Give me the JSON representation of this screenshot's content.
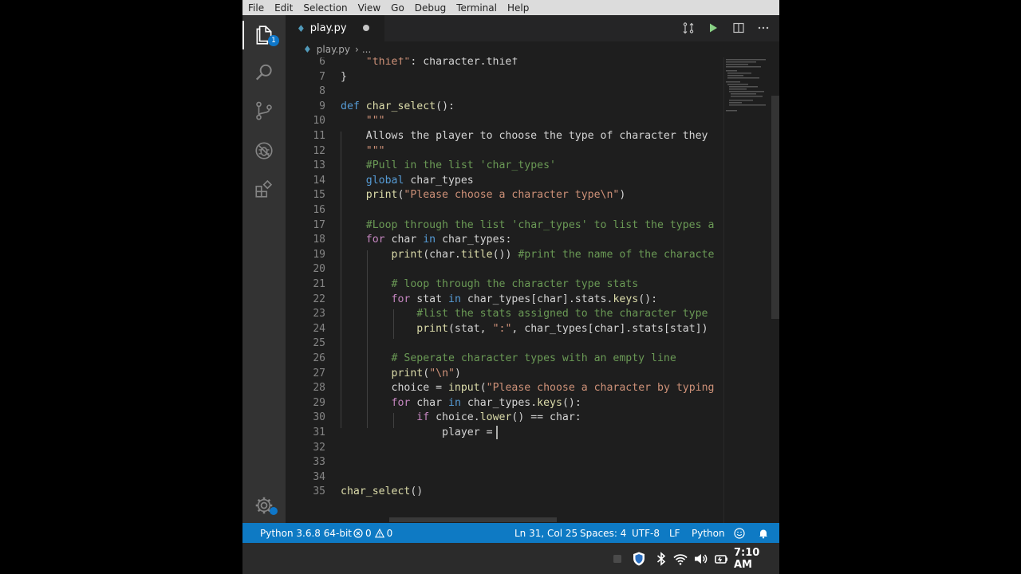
{
  "menu": [
    "File",
    "Edit",
    "Selection",
    "View",
    "Go",
    "Debug",
    "Terminal",
    "Help"
  ],
  "activity_bar": {
    "explorer_badge": "1",
    "items": [
      "explorer-icon",
      "search-icon",
      "source-control-icon",
      "debug-icon",
      "extensions-icon",
      "manage-gear-icon"
    ]
  },
  "tab": {
    "icon": "python-icon",
    "label": "play.py",
    "dirty": true
  },
  "editor_actions": [
    "open-changes-icon",
    "run-icon",
    "split-editor-icon",
    "more-actions-icon"
  ],
  "breadcrumb": {
    "file": "play.py",
    "more": "..."
  },
  "editor": {
    "line_numbers": [
      "6",
      "7",
      "8",
      "9",
      "10",
      "11",
      "12",
      "13",
      "14",
      "15",
      "16",
      "17",
      "18",
      "19",
      "20",
      "21",
      "22",
      "23",
      "24",
      "25",
      "26",
      "27",
      "28",
      "29",
      "30",
      "31",
      "32",
      "33",
      "34",
      "35"
    ],
    "lines": [
      "    \"thief\": character.thief",
      "}",
      "",
      "def char_select():",
      "    \"\"\"",
      "    Allows the player to choose the type of character they",
      "    \"\"\"",
      "    #Pull in the list 'char_types'",
      "    global char_types",
      "    print(\"Please choose a character type\\n\")",
      "",
      "    #Loop through the list 'char_types' to list the types a",
      "    for char in char_types:",
      "        print(char.title()) #print the name of the characte",
      "",
      "        # loop through the character type stats",
      "        for stat in char_types[char].stats.keys():",
      "            #list the stats assigned to the character type",
      "            print(stat, \":\", char_types[char].stats[stat])",
      "",
      "        # Seperate character types with an empty line",
      "        print(\"\\n\")",
      "        choice = input(\"Please choose a character by typing",
      "        for char in char_types.keys():",
      "            if choice.lower() == char:",
      "                player = ",
      "",
      "",
      "",
      "char_select()"
    ]
  },
  "status_bar": {
    "interpreter": "Python 3.6.8 64-bit",
    "errors": "0",
    "warnings": "0",
    "cursor_position": "Ln 31, Col 25",
    "indentation": "Spaces: 4",
    "encoding": "UTF-8",
    "eol": "LF",
    "language": "Python"
  },
  "taskbar": {
    "tray_icons": [
      "notification-icon",
      "shield-icon",
      "bluetooth-icon",
      "wifi-icon",
      "volume-icon",
      "battery-icon"
    ],
    "clock": "7:10 AM"
  },
  "colors": {
    "status_bar": "#0e7ac4",
    "activity_bar": "#333333",
    "editor_bg": "#1e1e1e",
    "keyword": "#569cd6",
    "function": "#dcdcaa",
    "string": "#ce9178",
    "comment": "#6a9955"
  }
}
